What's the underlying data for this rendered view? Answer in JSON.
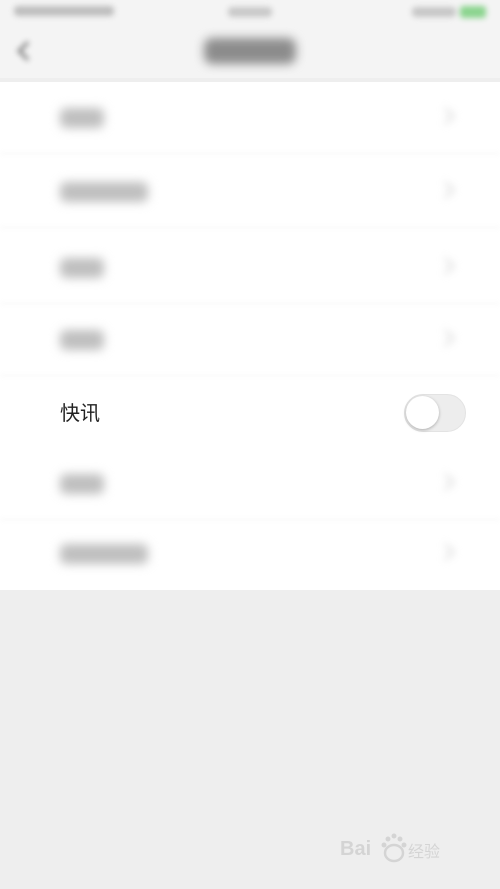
{
  "settings": {
    "rows": [
      {
        "label": "快讯",
        "toggle_on": false
      }
    ]
  },
  "colors": {
    "background": "#eeeeee",
    "list_background": "#ffffff",
    "toggle_track_off": "#ededed",
    "status_battery": "#8bd48e"
  },
  "icons": [
    "back-arrow-icon",
    "chevron-right-icon",
    "toggle-switch",
    "baidu-logo"
  ]
}
